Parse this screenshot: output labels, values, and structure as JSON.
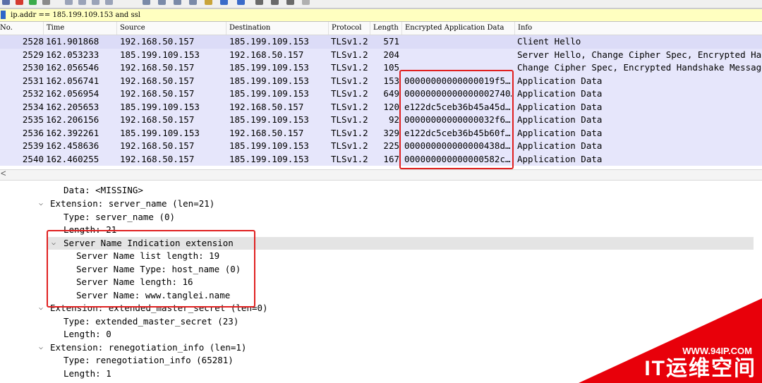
{
  "filter": {
    "value": "ip.addr == 185.199.109.153 and ssl"
  },
  "columns": [
    "No.",
    "Time",
    "Source",
    "Destination",
    "Protocol",
    "Length",
    "Encrypted Application Data",
    "Info"
  ],
  "packets": [
    {
      "no": "2528",
      "time": "161.901868",
      "src": "192.168.50.157",
      "dst": "185.199.109.153",
      "proto": "TLSv1.2",
      "len": "571",
      "enc": "",
      "info": "Client Hello"
    },
    {
      "no": "2529",
      "time": "162.053233",
      "src": "185.199.109.153",
      "dst": "192.168.50.157",
      "proto": "TLSv1.2",
      "len": "204",
      "enc": "",
      "info": "Server Hello, Change Cipher Spec, Encrypted Han"
    },
    {
      "no": "2530",
      "time": "162.056546",
      "src": "192.168.50.157",
      "dst": "185.199.109.153",
      "proto": "TLSv1.2",
      "len": "105",
      "enc": "",
      "info": "Change Cipher Spec, Encrypted Handshake Message"
    },
    {
      "no": "2531",
      "time": "162.056741",
      "src": "192.168.50.157",
      "dst": "185.199.109.153",
      "proto": "TLSv1.2",
      "len": "153",
      "enc": "00000000000000019f5…",
      "info": "Application Data"
    },
    {
      "no": "2532",
      "time": "162.056954",
      "src": "192.168.50.157",
      "dst": "185.199.109.153",
      "proto": "TLSv1.2",
      "len": "649",
      "enc": "00000000000000002740…",
      "info": "Application Data"
    },
    {
      "no": "2534",
      "time": "162.205653",
      "src": "185.199.109.153",
      "dst": "192.168.50.157",
      "proto": "TLSv1.2",
      "len": "120",
      "enc": "e122dc5ceb36b45a45d…",
      "info": "Application Data"
    },
    {
      "no": "2535",
      "time": "162.206156",
      "src": "192.168.50.157",
      "dst": "185.199.109.153",
      "proto": "TLSv1.2",
      "len": "92",
      "enc": "00000000000000032f6…",
      "info": "Application Data"
    },
    {
      "no": "2536",
      "time": "162.392261",
      "src": "185.199.109.153",
      "dst": "192.168.50.157",
      "proto": "TLSv1.2",
      "len": "329",
      "enc": "e122dc5ceb36b45b60f…",
      "info": "Application Data"
    },
    {
      "no": "2539",
      "time": "162.458636",
      "src": "192.168.50.157",
      "dst": "185.199.109.153",
      "proto": "TLSv1.2",
      "len": "225",
      "enc": "000000000000000438d…",
      "info": "Application Data"
    },
    {
      "no": "2540",
      "time": "162.460255",
      "src": "192.168.50.157",
      "dst": "185.199.109.153",
      "proto": "TLSv1.2",
      "len": "167",
      "enc": "000000000000000582c…",
      "info": "Application Data"
    }
  ],
  "details": [
    {
      "text": "Data: <MISSING>",
      "arrow": ""
    },
    {
      "text": "Extension: server_name (len=21)",
      "arrow": "expanded"
    },
    {
      "text": "Type: server_name (0)",
      "arrow": ""
    },
    {
      "text": "Length: 21",
      "arrow": ""
    },
    {
      "text": "Server Name Indication extension",
      "arrow": "expanded"
    },
    {
      "text": "Server Name list length: 19",
      "arrow": ""
    },
    {
      "text": "Server Name Type: host_name (0)",
      "arrow": ""
    },
    {
      "text": "Server Name length: 16",
      "arrow": ""
    },
    {
      "text": "Server Name: www.tanglei.name",
      "arrow": ""
    },
    {
      "text": "Extension: extended_master_secret (len=0)",
      "arrow": "expanded"
    },
    {
      "text": "Type: extended_master_secret (23)",
      "arrow": ""
    },
    {
      "text": "Length: 0",
      "arrow": ""
    },
    {
      "text": "Extension: renegotiation_info (len=1)",
      "arrow": "expanded"
    },
    {
      "text": "Type: renegotiation_info (65281)",
      "arrow": ""
    },
    {
      "text": "Length: 1",
      "arrow": ""
    }
  ],
  "scroll_left_glyph": "<",
  "watermark": {
    "url": "WWW.94IP.COM",
    "name": "IT运维空间"
  },
  "colors": {
    "row_bg": "#e6e6fb",
    "highlight_box": "#e02020",
    "filter_bg": "#ffffc0",
    "watermark": "#e8000a"
  }
}
